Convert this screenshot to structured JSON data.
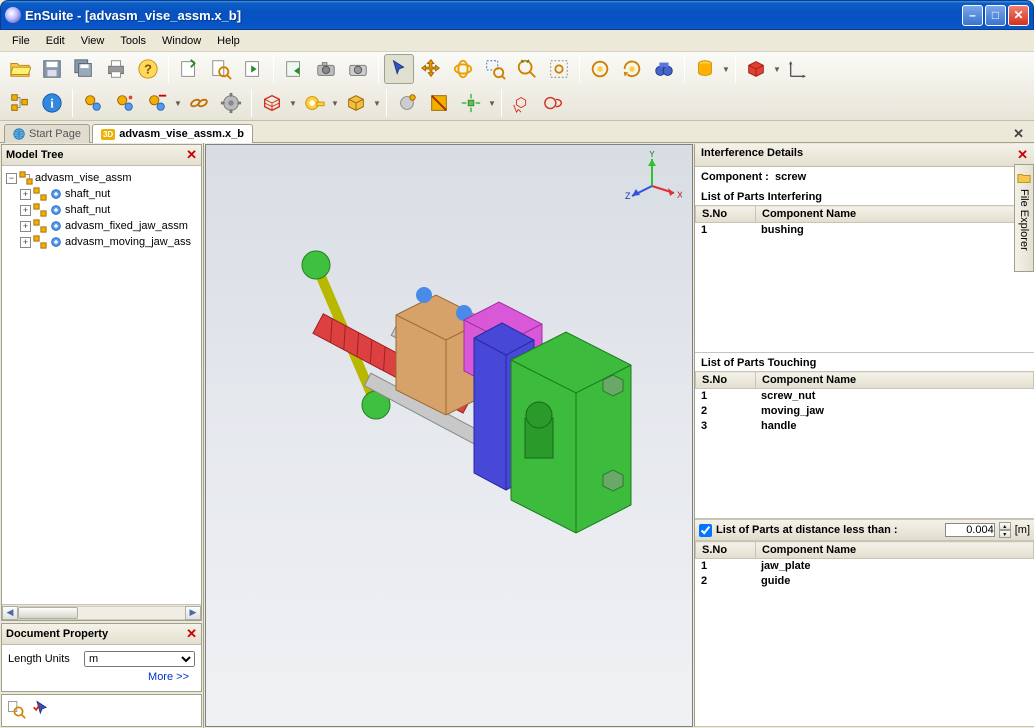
{
  "window": {
    "title": "EnSuite - [advasm_vise_assm.x_b]"
  },
  "menus": [
    "File",
    "Edit",
    "View",
    "Tools",
    "Window",
    "Help"
  ],
  "tabs": {
    "start": "Start Page",
    "doc": "advasm_vise_assm.x_b",
    "doc_prefix": "3D"
  },
  "side_tab": "File Explorer",
  "model_tree": {
    "title": "Model Tree",
    "root": "advasm_vise_assm",
    "children": [
      "shaft_nut",
      "shaft_nut",
      "advasm_fixed_jaw_assm",
      "advasm_moving_jaw_ass"
    ]
  },
  "doc_prop": {
    "title": "Document Property",
    "length_units_label": "Length Units",
    "length_units_value": "m",
    "more": "More >>"
  },
  "axis": {
    "x": "X",
    "y": "Y",
    "z": "Z"
  },
  "interference": {
    "title": "Interference Details",
    "component_label": "Component :",
    "component": "screw",
    "interfering_label": "List of Parts Interfering",
    "col_sno": "S.No",
    "col_name": "Component Name",
    "interfering": [
      {
        "sno": "1",
        "name": "bushing"
      }
    ],
    "touching_label": "List of Parts Touching",
    "touching": [
      {
        "sno": "1",
        "name": "screw_nut"
      },
      {
        "sno": "2",
        "name": "moving_jaw"
      },
      {
        "sno": "3",
        "name": "handle"
      }
    ],
    "distance_label": "List of Parts at distance less than :",
    "distance_value": "0.004",
    "distance_unit": "[m]",
    "within_distance": [
      {
        "sno": "1",
        "name": "jaw_plate"
      },
      {
        "sno": "2",
        "name": "guide"
      }
    ]
  }
}
